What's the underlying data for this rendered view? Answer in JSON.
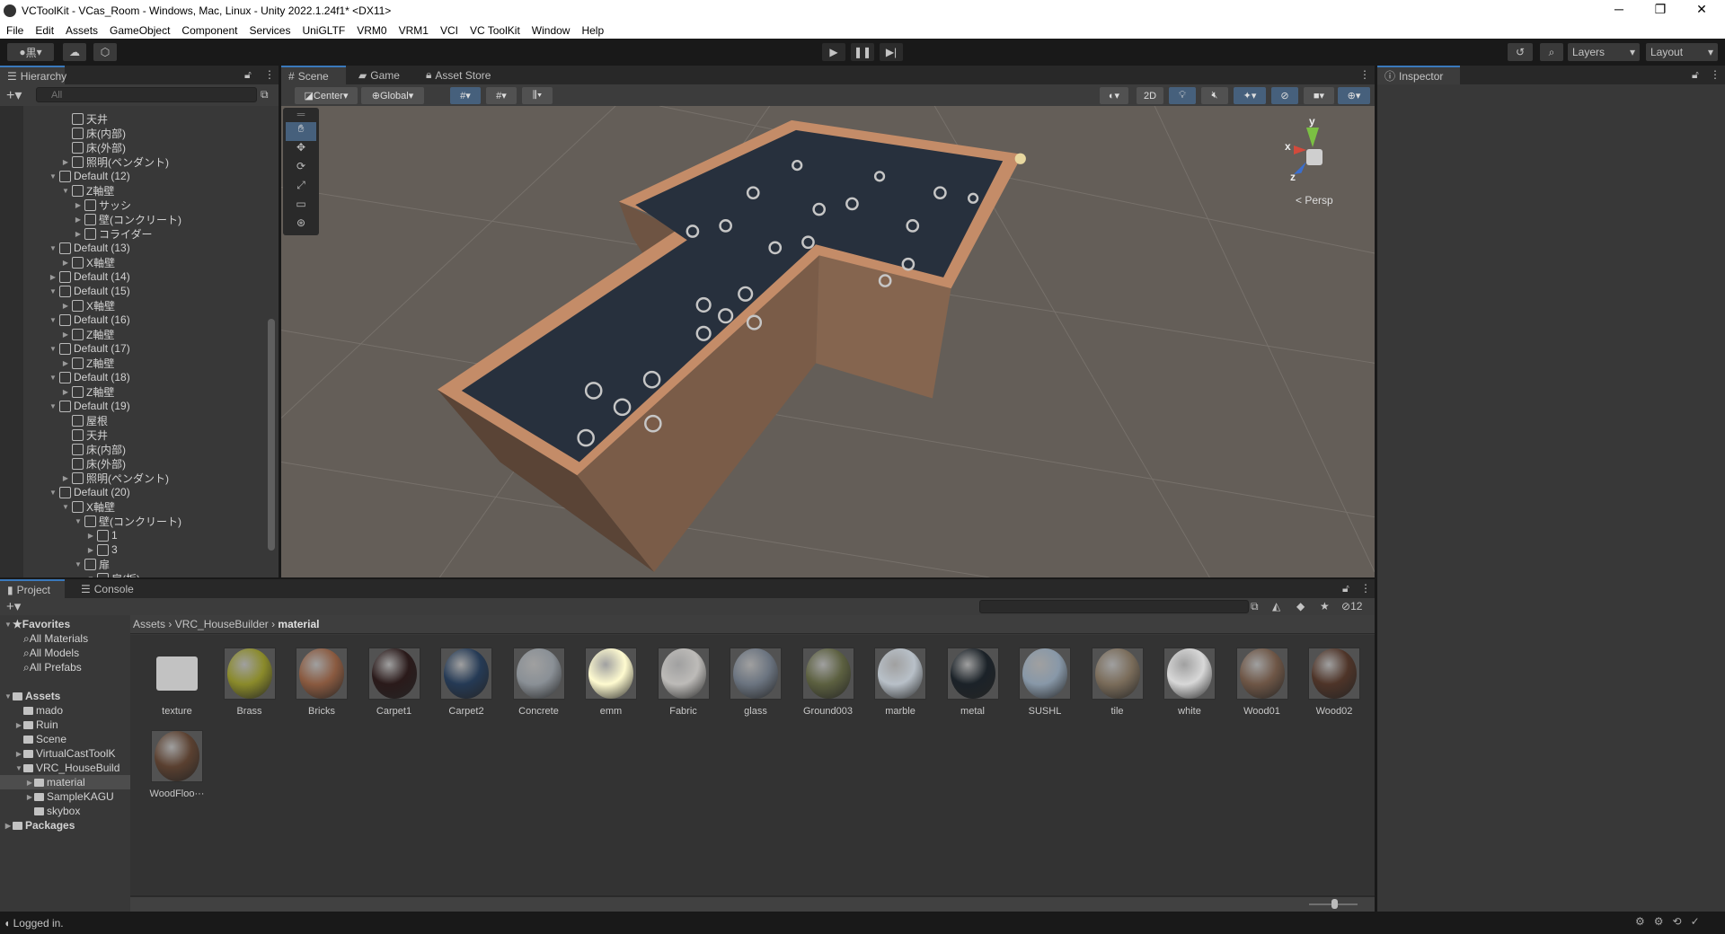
{
  "window": {
    "title": "VCToolKit - VCas_Room - Windows, Mac, Linux - Unity 2022.1.24f1* <DX11>",
    "controls": [
      "minimize",
      "restore",
      "close"
    ]
  },
  "menu": [
    "File",
    "Edit",
    "Assets",
    "GameObject",
    "Component",
    "Services",
    "UniGLTF",
    "VRM0",
    "VRM1",
    "VCI",
    "VC ToolKit",
    "Window",
    "Help"
  ],
  "toolbar": {
    "account_label": "黒",
    "play_icon": "play-icon",
    "pause_icon": "pause-icon",
    "step_icon": "step-icon",
    "layers_label": "Layers",
    "layout_label": "Layout"
  },
  "hierarchy": {
    "title": "Hierarchy",
    "search_placeholder": "All",
    "items": [
      {
        "label": "天井",
        "level": 2,
        "arrow": "none"
      },
      {
        "label": "床(内部)",
        "level": 2,
        "arrow": "none"
      },
      {
        "label": "床(外部)",
        "level": 2,
        "arrow": "none"
      },
      {
        "label": "照明(ペンダント)",
        "level": 2,
        "arrow": "right"
      },
      {
        "label": "Default (12)",
        "level": 1,
        "arrow": "down"
      },
      {
        "label": "Z軸壁",
        "level": 2,
        "arrow": "down"
      },
      {
        "label": "サッシ",
        "level": 3,
        "arrow": "right"
      },
      {
        "label": "壁(コンクリート)",
        "level": 3,
        "arrow": "right"
      },
      {
        "label": "コライダー",
        "level": 3,
        "arrow": "right"
      },
      {
        "label": "Default (13)",
        "level": 1,
        "arrow": "down"
      },
      {
        "label": "X軸壁",
        "level": 2,
        "arrow": "right"
      },
      {
        "label": "Default (14)",
        "level": 1,
        "arrow": "right"
      },
      {
        "label": "Default (15)",
        "level": 1,
        "arrow": "down"
      },
      {
        "label": "X軸壁",
        "level": 2,
        "arrow": "right"
      },
      {
        "label": "Default (16)",
        "level": 1,
        "arrow": "down"
      },
      {
        "label": "Z軸壁",
        "level": 2,
        "arrow": "right"
      },
      {
        "label": "Default (17)",
        "level": 1,
        "arrow": "down"
      },
      {
        "label": "Z軸壁",
        "level": 2,
        "arrow": "right"
      },
      {
        "label": "Default (18)",
        "level": 1,
        "arrow": "down"
      },
      {
        "label": "Z軸壁",
        "level": 2,
        "arrow": "right"
      },
      {
        "label": "Default (19)",
        "level": 1,
        "arrow": "down"
      },
      {
        "label": "屋根",
        "level": 2,
        "arrow": "none"
      },
      {
        "label": "天井",
        "level": 2,
        "arrow": "none"
      },
      {
        "label": "床(内部)",
        "level": 2,
        "arrow": "none"
      },
      {
        "label": "床(外部)",
        "level": 2,
        "arrow": "none"
      },
      {
        "label": "照明(ペンダント)",
        "level": 2,
        "arrow": "right"
      },
      {
        "label": "Default (20)",
        "level": 1,
        "arrow": "down"
      },
      {
        "label": "X軸壁",
        "level": 2,
        "arrow": "down"
      },
      {
        "label": "壁(コンクリート)",
        "level": 3,
        "arrow": "down"
      },
      {
        "label": "1",
        "level": 4,
        "arrow": "right"
      },
      {
        "label": "3",
        "level": 4,
        "arrow": "right"
      },
      {
        "label": "扉",
        "level": 3,
        "arrow": "down"
      },
      {
        "label": "扉(板)",
        "level": 4,
        "arrow": "down"
      }
    ]
  },
  "scene": {
    "tabs": [
      "Scene",
      "Game",
      "Asset Store"
    ],
    "pivot_label": "Center",
    "space_label": "Global",
    "mode_2d": "2D",
    "projection_label": "Persp",
    "gizmo_axes": {
      "x": "x",
      "y": "y",
      "z": "z"
    }
  },
  "inspector": {
    "title": "Inspector"
  },
  "project": {
    "tabs": [
      "Project",
      "Console"
    ],
    "hidden_count": "12",
    "breadcrumb": [
      "Assets",
      "VRC_HouseBuilder",
      "material"
    ],
    "tree": [
      {
        "label": "Favorites",
        "level": 0,
        "arrow": "down",
        "icon": "star",
        "bold": true
      },
      {
        "label": "All Materials",
        "level": 1,
        "arrow": "none",
        "icon": "search"
      },
      {
        "label": "All Models",
        "level": 1,
        "arrow": "none",
        "icon": "search"
      },
      {
        "label": "All Prefabs",
        "level": 1,
        "arrow": "none",
        "icon": "search"
      },
      {
        "label": "",
        "level": 0,
        "arrow": "none",
        "icon": "none"
      },
      {
        "label": "Assets",
        "level": 0,
        "arrow": "down",
        "icon": "folder-open",
        "bold": true
      },
      {
        "label": "mado",
        "level": 1,
        "arrow": "none",
        "icon": "folder"
      },
      {
        "label": "Ruin",
        "level": 1,
        "arrow": "right",
        "icon": "folder"
      },
      {
        "label": "Scene",
        "level": 1,
        "arrow": "none",
        "icon": "folder"
      },
      {
        "label": "VirtualCastToolK",
        "level": 1,
        "arrow": "right",
        "icon": "folder"
      },
      {
        "label": "VRC_HouseBuild",
        "level": 1,
        "arrow": "down",
        "icon": "folder-open"
      },
      {
        "label": "material",
        "level": 2,
        "arrow": "right",
        "icon": "folder",
        "selected": true
      },
      {
        "label": "SampleKAGU",
        "level": 2,
        "arrow": "right",
        "icon": "folder"
      },
      {
        "label": "skybox",
        "level": 2,
        "arrow": "none",
        "icon": "folder"
      },
      {
        "label": "Packages",
        "level": 0,
        "arrow": "right",
        "icon": "folder",
        "bold": true
      }
    ],
    "assets": [
      {
        "label": "texture",
        "type": "folder"
      },
      {
        "label": "Brass",
        "color": "#8a8a2a"
      },
      {
        "label": "Bricks",
        "color": "#8a5a40"
      },
      {
        "label": "Carpet1",
        "color": "#2a1a1a"
      },
      {
        "label": "Carpet2",
        "color": "#253a55"
      },
      {
        "label": "Concrete",
        "color": "#8a9096"
      },
      {
        "label": "emm",
        "color": "#fffbd0"
      },
      {
        "label": "Fabric",
        "color": "#bdbbb8"
      },
      {
        "label": "glass",
        "color": "#6b7480"
      },
      {
        "label": "Ground003",
        "color": "#5c6040"
      },
      {
        "label": "marble",
        "color": "#b8c0c8"
      },
      {
        "label": "metal",
        "color": "#1b2228"
      },
      {
        "label": "SUSHL",
        "color": "#8898a8"
      },
      {
        "label": "tile",
        "color": "#7a6c5a"
      },
      {
        "label": "white",
        "color": "#d8d8d8"
      },
      {
        "label": "Wood01",
        "color": "#6e5646"
      },
      {
        "label": "Wood02",
        "color": "#4e3428"
      },
      {
        "label": "WoodFloo···",
        "color": "#5a4030"
      }
    ]
  },
  "status": {
    "text": "Logged in."
  }
}
